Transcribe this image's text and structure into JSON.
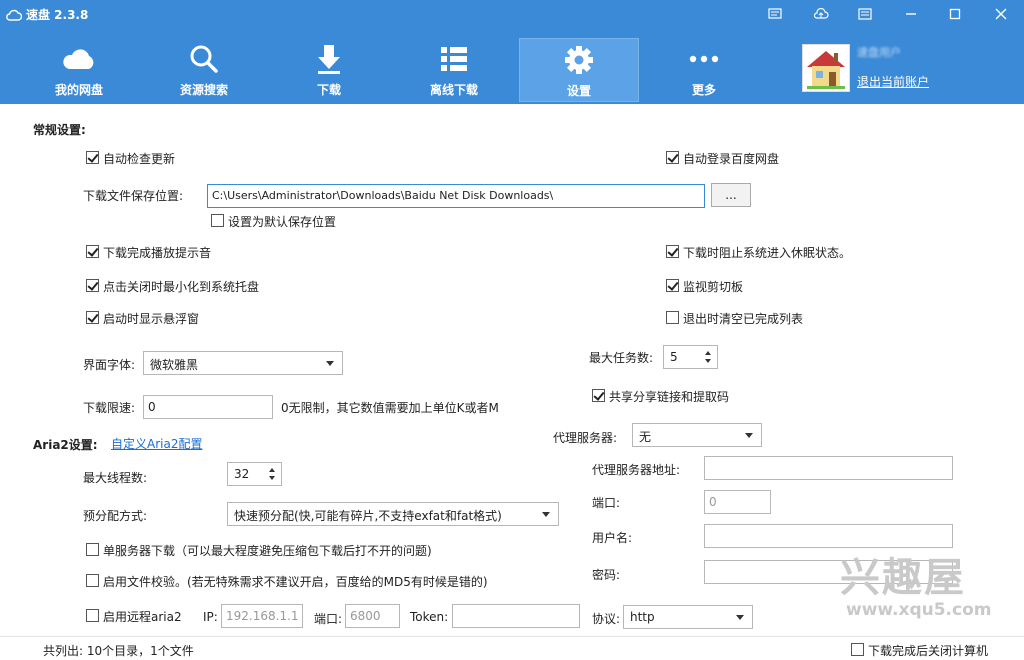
{
  "app": {
    "title": "速盘 2.3.8"
  },
  "nav": {
    "tabs": [
      {
        "label": "我的网盘",
        "icon": "cloud-icon"
      },
      {
        "label": "资源搜索",
        "icon": "search-icon"
      },
      {
        "label": "下载",
        "icon": "download-icon"
      },
      {
        "label": "离线下载",
        "icon": "list-icon"
      },
      {
        "label": "设置",
        "icon": "gear-icon",
        "active": true
      },
      {
        "label": "更多",
        "icon": "more-icon"
      }
    ]
  },
  "user": {
    "name": "速盘用户",
    "logout": "退出当前账户"
  },
  "general": {
    "heading": "常规设置:",
    "auto_check_update": {
      "label": "自动检查更新",
      "checked": true
    },
    "auto_login": {
      "label": "自动登录百度网盘",
      "checked": true
    },
    "save_path_label": "下载文件保存位置:",
    "save_path": "C:\\Users\\Administrator\\Downloads\\Baidu Net Disk Downloads\\",
    "browse": "...",
    "default_path": {
      "label": "设置为默认保存位置",
      "checked": false
    },
    "play_sound": {
      "label": "下载完成播放提示音",
      "checked": true
    },
    "prevent_sleep": {
      "label": "下载时阻止系统进入休眠状态。",
      "checked": true
    },
    "minimize_tray": {
      "label": "点击关闭时最小化到系统托盘",
      "checked": true
    },
    "watch_clipboard": {
      "label": "监视剪切板",
      "checked": true
    },
    "float_window": {
      "label": "启动时显示悬浮窗",
      "checked": true
    },
    "clear_completed": {
      "label": "退出时清空已完成列表",
      "checked": false
    },
    "font_label": "界面字体:",
    "font_value": "微软雅黑",
    "max_tasks_label": "最大任务数:",
    "max_tasks": "5",
    "share_link": {
      "label": "共享分享链接和提取码",
      "checked": true
    },
    "speed_label": "下载限速:",
    "speed_value": "0",
    "speed_hint": "0无限制，其它数值需要加上单位K或者M"
  },
  "proxy": {
    "label": "代理服务器:",
    "value": "无",
    "address_label": "代理服务器地址:",
    "address": "",
    "port_label": "端口:",
    "port": "0",
    "username_label": "用户名:",
    "username": "",
    "password_label": "密码:",
    "password": ""
  },
  "aria2": {
    "heading": "Aria2设置:",
    "custom_link": "自定义Aria2配置",
    "threads_label": "最大线程数:",
    "threads": "32",
    "prealloc_label": "预分配方式:",
    "prealloc": "快速预分配(快,可能有碎片,不支持exfat和fat格式)",
    "single_server": {
      "label": "单服务器下载（可以最大程度避免压缩包下载后打不开的问题)",
      "checked": false
    },
    "verify": {
      "label": "启用文件校验。(若无特殊需求不建议开启，百度给的MD5有时候是错的)",
      "checked": false
    },
    "remote": {
      "label": "启用远程aria2",
      "checked": false
    },
    "ip_label": "IP:",
    "ip": "192.168.1.1",
    "port_label": "端口:",
    "port": "6800",
    "token_label": "Token:",
    "token": "",
    "protocol_label": "协议:",
    "protocol": "http"
  },
  "status": {
    "summary": "共列出: 10个目录，1个文件",
    "shutdown": {
      "label": "下载完成后关闭计算机",
      "checked": false
    }
  },
  "watermark": {
    "text": "兴趣屋",
    "url": "www.xqu5.com"
  }
}
